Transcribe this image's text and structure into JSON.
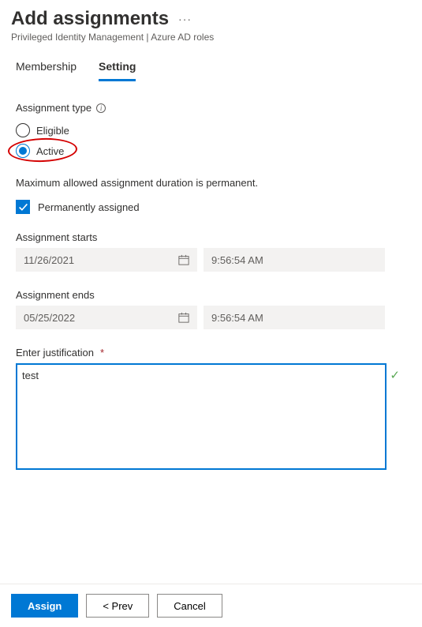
{
  "header": {
    "title": "Add assignments",
    "breadcrumb": "Privileged Identity Management | Azure AD roles"
  },
  "tabs": {
    "membership": "Membership",
    "setting": "Setting"
  },
  "form": {
    "assignment_type_label": "Assignment type",
    "radio_eligible": "Eligible",
    "radio_active": "Active",
    "max_duration_hint": "Maximum allowed assignment duration is permanent.",
    "permanently_assigned": "Permanently assigned",
    "assignment_starts_label": "Assignment starts",
    "start_date": "11/26/2021",
    "start_time": "9:56:54 AM",
    "assignment_ends_label": "Assignment ends",
    "end_date": "05/25/2022",
    "end_time": "9:56:54 AM",
    "justification_label": "Enter justification",
    "justification_value": "test"
  },
  "buttons": {
    "assign": "Assign",
    "prev": "< Prev",
    "cancel": "Cancel"
  }
}
